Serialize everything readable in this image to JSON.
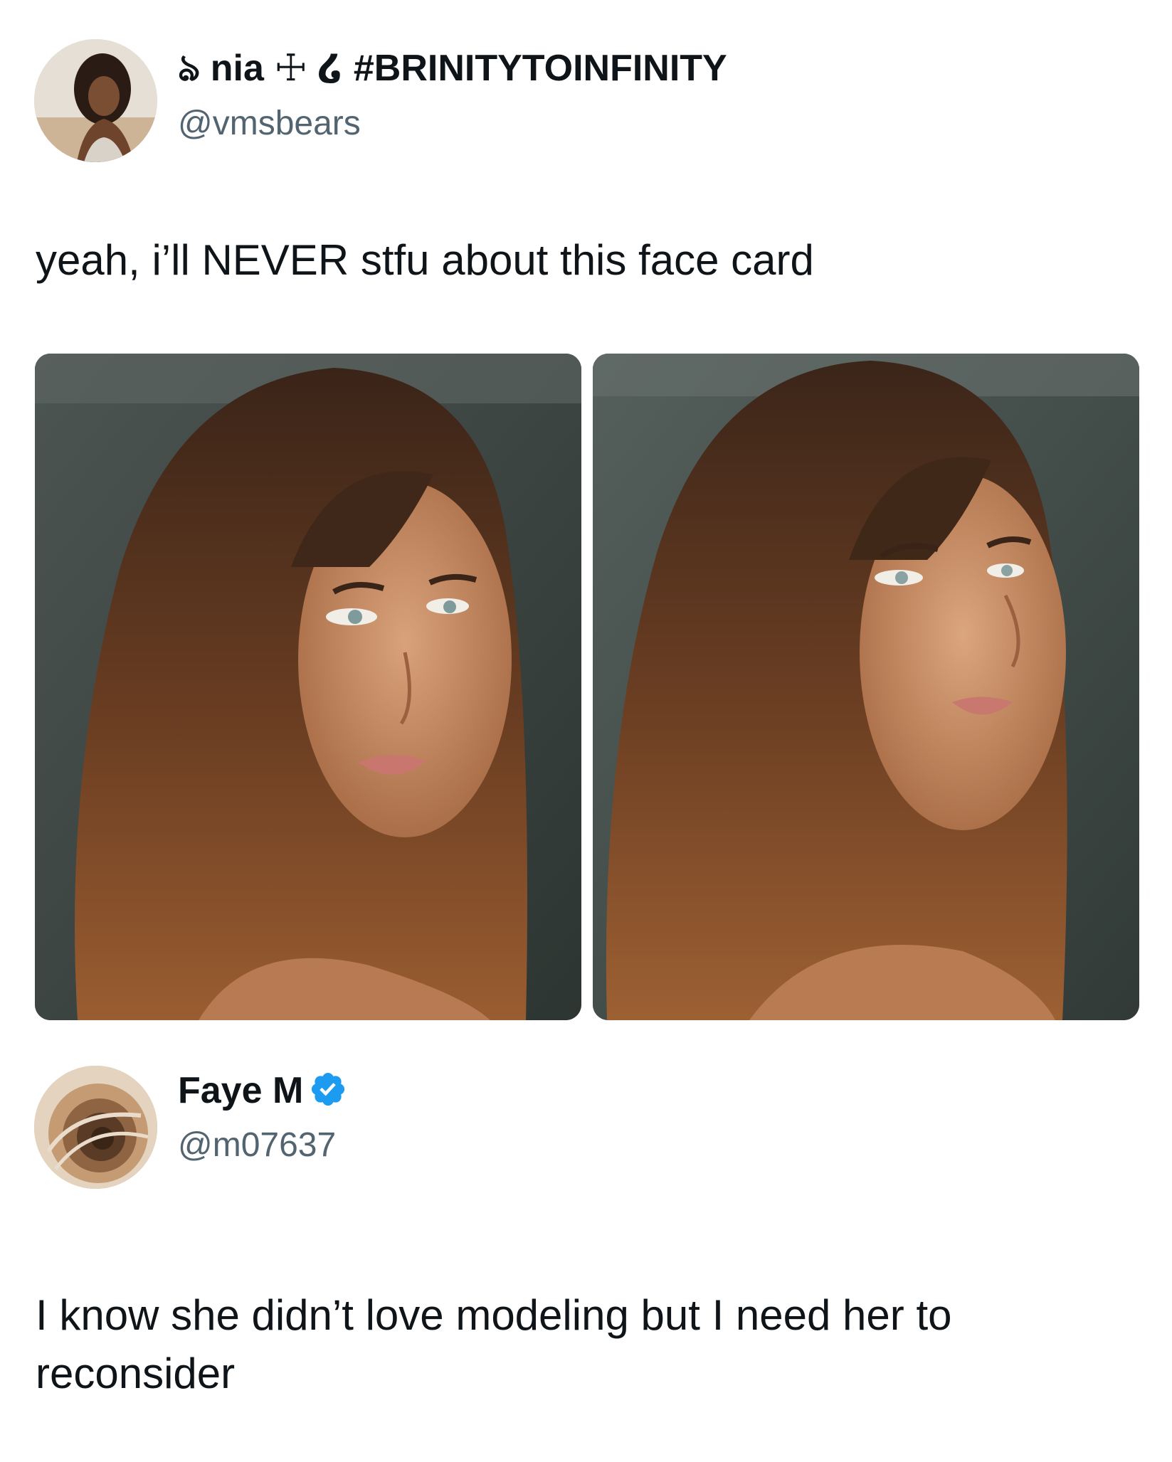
{
  "tweet1": {
    "display_name_prefix": "ঌ nia ☩ ໒",
    "display_name_hashtag": "#BRINITYTOINFINITY",
    "handle": "@vmsbears",
    "text": "yeah, i’ll NEVER stfu about this face card",
    "avatar_icon": "profile-photo-icon"
  },
  "tweet2": {
    "display_name": "Faye M",
    "verified_icon": "verified-badge-icon",
    "handle": "@m07637",
    "text": "I know she didn’t love modeling but I need her to reconsider",
    "avatar_icon": "profile-photo-icon"
  },
  "colors": {
    "primary_text": "#0f1419",
    "secondary_text": "#536471",
    "verified_blue": "#1d9bf0",
    "background": "#ffffff"
  }
}
